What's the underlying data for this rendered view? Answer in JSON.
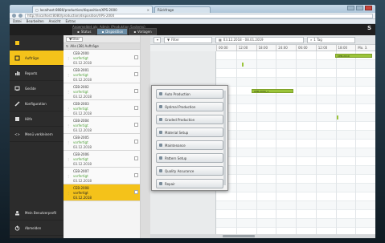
{
  "browser": {
    "tab_title": "localhost:8080/production/disposition/XPS-2000",
    "tab2_title": "Rückfrage",
    "address": "http://localhost:8080/production/disposition/XPS-2000",
    "menu": [
      "Datei",
      "Bearbeiten",
      "Ansicht",
      "Extras"
    ]
  },
  "app": {
    "hint": "Angemeldet als: Admin (Produktion Systems)",
    "logo": "S",
    "top_tabs": [
      {
        "label": "Status"
      },
      {
        "label": "Disposition"
      },
      {
        "label": "Vorlagen"
      }
    ]
  },
  "sidebar": {
    "items": [
      {
        "label": "",
        "icon": "user-icon"
      },
      {
        "label": "Aufträge",
        "icon": "orders-icon"
      },
      {
        "label": "Reports",
        "icon": "chart-icon"
      },
      {
        "label": "Geräte",
        "icon": "device-icon"
      },
      {
        "label": "Konfiguration",
        "icon": "wrench-icon"
      },
      {
        "label": "Hilfe",
        "icon": "book-icon"
      },
      {
        "label": "Menü verkleinern",
        "icon": "collapse-icon"
      }
    ],
    "bottom": [
      {
        "label": "Mein Benutzerprofil",
        "icon": "profile-icon"
      },
      {
        "label": "Abmelden",
        "icon": "power-icon"
      }
    ]
  },
  "orders": {
    "filter_label": "Filter",
    "group_label": "Alle (38) Aufträge",
    "cards": [
      {
        "id": "CEB-2000",
        "status": "vorfertigt",
        "date": "03.12.2018"
      },
      {
        "id": "CEB-2001",
        "status": "vorfertigt",
        "date": "03.12.2018"
      },
      {
        "id": "CEB-2002",
        "status": "vorfertigt",
        "date": "03.12.2018"
      },
      {
        "id": "CEB-2003",
        "status": "vorfertigt",
        "date": "03.12.2018"
      },
      {
        "id": "CEB-2004",
        "status": "vorfertigt",
        "date": "03.12.2018"
      },
      {
        "id": "CEB-2005",
        "status": "vorfertigt",
        "date": "03.12.2018"
      },
      {
        "id": "CEB-2006",
        "status": "vorfertigt",
        "date": "03.12.2018"
      },
      {
        "id": "CEB-2007",
        "status": "vorfertigt",
        "date": "03.12.2018"
      },
      {
        "id": "CEB-2008",
        "status": "vorfertigt",
        "date": "03.12.2018"
      }
    ]
  },
  "main": {
    "filter_label": "Filter",
    "date_range": "03.12.2018 - 08.01.2019",
    "view_label": "1 Tag",
    "time_labels": [
      "00:00",
      "12:00",
      "18:00",
      "24:00",
      "06:00",
      "12:00",
      "18:00",
      "Mo. 3."
    ],
    "bars": [
      {
        "label": "CEB-2010",
        "lane": 0
      },
      {
        "label": "CEB-2000_1",
        "lane": 4
      }
    ]
  },
  "popup": {
    "items": [
      "Auto Production",
      "Optimal Production",
      "Graded Production",
      "Material Setup",
      "Maintenance",
      "Pattern Setup",
      "Quality Assurance",
      "Repair"
    ]
  }
}
